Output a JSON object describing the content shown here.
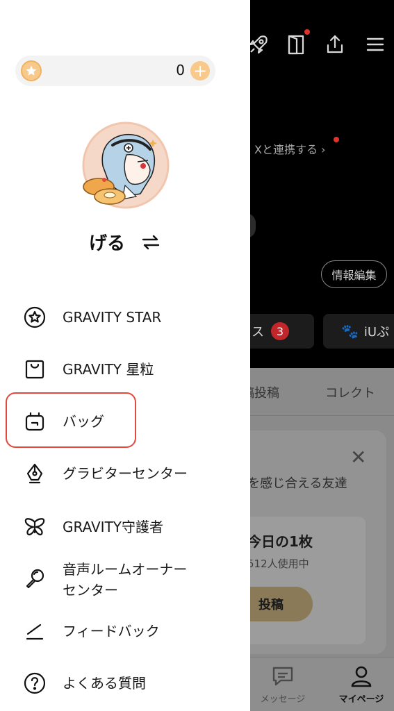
{
  "drawer": {
    "coins": {
      "value": "0"
    },
    "username": "げる",
    "menu": [
      {
        "label": "GRAVITY STAR",
        "icon": "star-badge-icon"
      },
      {
        "label": "GRAVITY 星粒",
        "icon": "shopping-bag-icon"
      },
      {
        "label": "バッグ",
        "icon": "backpack-icon"
      },
      {
        "label": "グラビターセンター",
        "icon": "pen-nib-icon"
      },
      {
        "label": "GRAVITY守護者",
        "icon": "butterfly-icon"
      },
      {
        "label": "音声ルームオーナー\nセンター",
        "icon": "microphone-icon"
      },
      {
        "label": "フィードバック",
        "icon": "edit-icon"
      },
      {
        "label": "よくある質問",
        "icon": "question-circle-icon"
      }
    ],
    "highlight_color": "#e2483c"
  },
  "background": {
    "x_link": "Xと連携する ›",
    "profile_edit": "情報編集",
    "chip_1": {
      "text": "ス",
      "badge": "3"
    },
    "chip_2": {
      "text": "iUぷ"
    },
    "tabs": [
      "稿投稿",
      "コレクト"
    ],
    "card": {
      "friends_text": "を感じ合える友達",
      "today_title": "今日の1枚",
      "today_users": "512人使用中",
      "post_button": "投稿"
    },
    "nav": {
      "messages": "メッセージ",
      "mypage": "マイページ"
    },
    "colors": {
      "accent_red": "#c1262b",
      "coin_gold": "#f7c98a"
    }
  }
}
